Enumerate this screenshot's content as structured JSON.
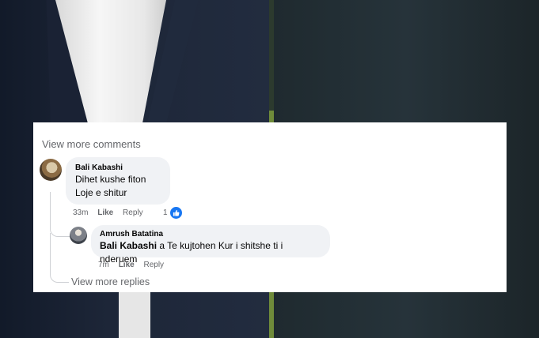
{
  "comments_header": {
    "view_more_comments": "View more comments"
  },
  "comments": [
    {
      "author": "Bali Kabashi",
      "lines": [
        "Dihet kushe fiton",
        "Loje e shitur"
      ],
      "time": "33m",
      "like_label": "Like",
      "reply_label": "Reply",
      "reaction_count": "1",
      "reaction_icon": "like-icon"
    }
  ],
  "reply": {
    "author": "Amrush Batatina",
    "mention": "Bali Kabashi",
    "text": " a Te kujtohen Kur i shitshe ti i nderuem",
    "time": "7m",
    "like_label": "Like",
    "reply_label": "Reply"
  },
  "footer": {
    "view_more_replies": "View more replies"
  },
  "colors": {
    "accent": "#1877f2",
    "muted": "#65676b",
    "bubble": "#f0f2f5"
  }
}
